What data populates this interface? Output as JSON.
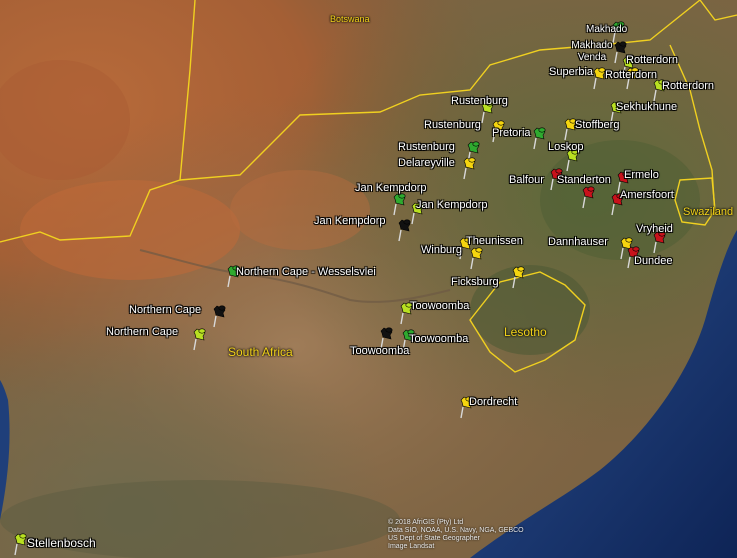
{
  "colors": {
    "green": "#2faa2f",
    "yellow_green": "#b9e021",
    "yellow": "#f5d50f",
    "red": "#c8121b",
    "black": "#111111",
    "border": "#f0d020"
  },
  "regions": {
    "botswana": "Botswana",
    "south_africa": "South Africa",
    "lesotho": "Lesotho",
    "swaziland": "Swaziland"
  },
  "places": {
    "makhado": "Makhado",
    "makhado_venda": "Makhado Venda",
    "rotterdorn_1": "Rotterdorn",
    "rotterdorn_2": "Rotterdorn",
    "rotterdorn_3": "Rotterdorn",
    "superbia": "Superbia",
    "sekhukhune": "Sekhukhune",
    "rustenburg_1": "Rustenburg",
    "rustenburg_2": "Rustenburg",
    "rustenburg_3": "Rustenburg",
    "pretoria": "Pretoria",
    "stoffberg": "Stoffberg",
    "loskop": "Loskop",
    "delareyville": "Delareyville",
    "balfour": "Balfour",
    "standerton": "Standerton",
    "ermelo": "Ermelo",
    "amersfoort": "Amersfoort",
    "jan_kempdorp_1": "Jan Kempdorp",
    "jan_kempdorp_2": "Jan Kempdorp",
    "jan_kempdorp_3": "Jan Kempdorp",
    "theunissen": "Theunissen",
    "winburg": "Winburg",
    "dannhauser": "Dannhauser",
    "vryheid": "Vryheid",
    "dundee": "Dundee",
    "northern_cape_wesselsvlei": "Northern Cape - Wesselsvlei",
    "ficksburg": "Ficksburg",
    "northern_cape_1": "Northern Cape",
    "northern_cape_2": "Northern Cape",
    "toowoomba_1": "Toowoomba",
    "toowoomba_2": "Toowoomba",
    "toowoomba_3": "Toowoomba",
    "dordrecht": "Dordrecht",
    "stellenbosch": "Stellenbosch"
  },
  "attribution": {
    "line1": "© 2018 AfriGIS (Pty) Ltd",
    "line2": "Data SIO, NOAA, U.S. Navy, NGA, GEBCO",
    "line3": "US Dept of State Geographer",
    "line4": "Image Landsat"
  }
}
